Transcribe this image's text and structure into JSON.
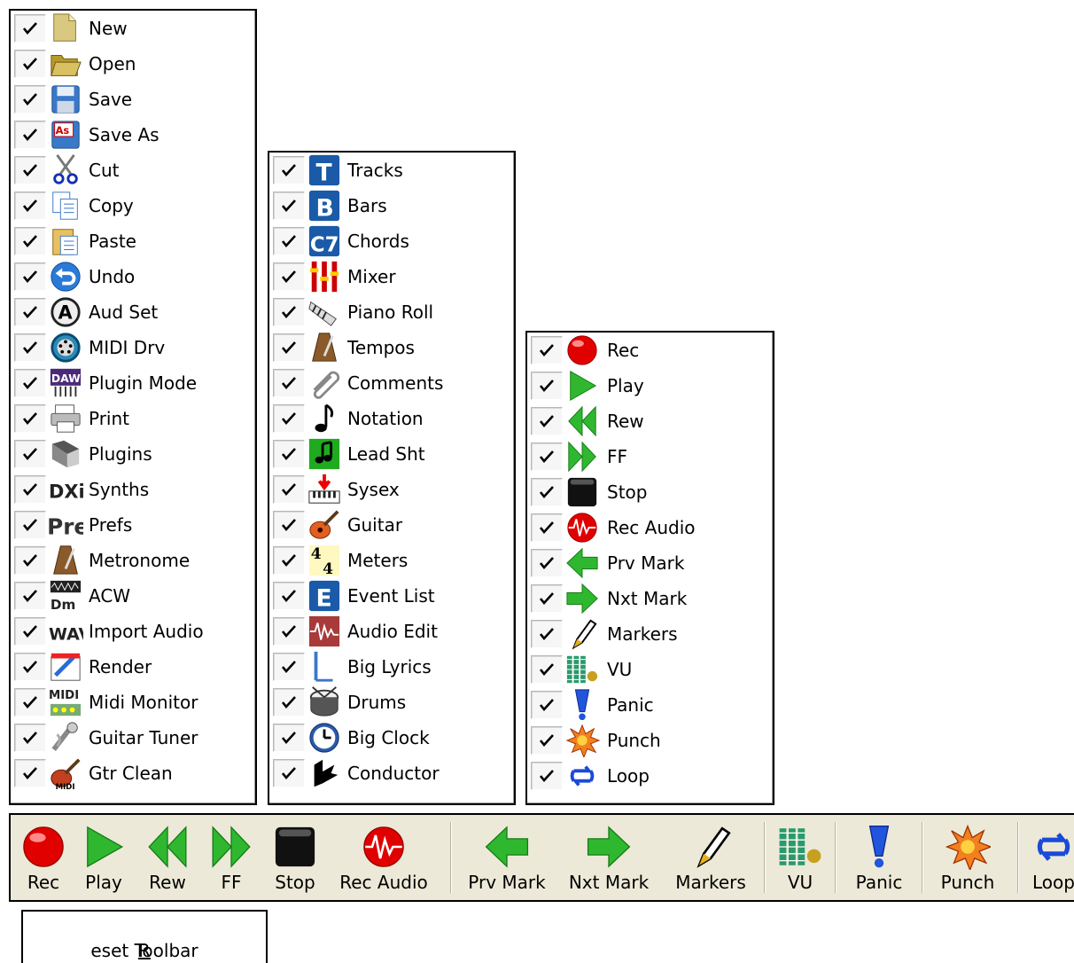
{
  "menus": [
    {
      "id": "file-edit",
      "items": [
        {
          "label": "New",
          "icon": "new-document-icon",
          "checked": true
        },
        {
          "label": "Open",
          "icon": "open-folder-icon",
          "checked": true
        },
        {
          "label": "Save",
          "icon": "save-disk-icon",
          "checked": true
        },
        {
          "label": "Save As",
          "icon": "save-as-icon",
          "checked": true
        },
        {
          "label": "Cut",
          "icon": "scissors-icon",
          "checked": true
        },
        {
          "label": "Copy",
          "icon": "copy-icon",
          "checked": true
        },
        {
          "label": "Paste",
          "icon": "paste-icon",
          "checked": true
        },
        {
          "label": "Undo",
          "icon": "undo-icon",
          "checked": true
        },
        {
          "label": "Aud Set",
          "icon": "audio-settings-icon",
          "checked": true
        },
        {
          "label": "MIDI Drv",
          "icon": "midi-driver-icon",
          "checked": true
        },
        {
          "label": "Plugin Mode",
          "icon": "daw-plugin-icon",
          "checked": true
        },
        {
          "label": "Print",
          "icon": "printer-icon",
          "checked": true
        },
        {
          "label": "Plugins",
          "icon": "plugins-icon",
          "checked": true
        },
        {
          "label": "Synths",
          "icon": "dxi-synths-icon",
          "checked": true
        },
        {
          "label": "Prefs",
          "icon": "prefs-icon",
          "checked": true
        },
        {
          "label": "Metronome",
          "icon": "metronome-icon",
          "checked": true
        },
        {
          "label": "ACW",
          "icon": "acw-icon",
          "checked": true
        },
        {
          "label": "Import Audio",
          "icon": "import-wav-icon",
          "checked": true
        },
        {
          "label": "Render",
          "icon": "render-icon",
          "checked": true
        },
        {
          "label": "Midi Monitor",
          "icon": "midi-monitor-icon",
          "checked": true
        },
        {
          "label": "Guitar Tuner",
          "icon": "guitar-tuner-icon",
          "checked": true
        },
        {
          "label": "Gtr Clean",
          "icon": "guitar-clean-icon",
          "checked": true
        }
      ]
    },
    {
      "id": "windows",
      "items": [
        {
          "label": "Tracks",
          "icon": "tracks-t-icon",
          "checked": true
        },
        {
          "label": "Bars",
          "icon": "bars-b-icon",
          "checked": true
        },
        {
          "label": "Chords",
          "icon": "chords-c7-icon",
          "checked": true
        },
        {
          "label": "Mixer",
          "icon": "mixer-faders-icon",
          "checked": true
        },
        {
          "label": "Piano Roll",
          "icon": "piano-roll-icon",
          "checked": true
        },
        {
          "label": "Tempos",
          "icon": "metronome-icon",
          "checked": true
        },
        {
          "label": "Comments",
          "icon": "paperclip-icon",
          "checked": true
        },
        {
          "label": "Notation",
          "icon": "music-note-icon",
          "checked": true
        },
        {
          "label": "Lead Sht",
          "icon": "lead-sheet-icon",
          "checked": true
        },
        {
          "label": "Sysex",
          "icon": "sysex-keyboard-icon",
          "checked": true
        },
        {
          "label": "Guitar",
          "icon": "guitar-icon",
          "checked": true
        },
        {
          "label": "Meters",
          "icon": "time-signature-icon",
          "checked": true
        },
        {
          "label": "Event List",
          "icon": "event-list-e-icon",
          "checked": true
        },
        {
          "label": "Audio Edit",
          "icon": "audio-waveform-icon",
          "checked": true
        },
        {
          "label": "Big Lyrics",
          "icon": "big-lyrics-icon",
          "checked": true
        },
        {
          "label": "Drums",
          "icon": "drum-icon",
          "checked": true
        },
        {
          "label": "Big Clock",
          "icon": "clock-icon",
          "checked": true
        },
        {
          "label": "Conductor",
          "icon": "conductor-icon",
          "checked": true
        }
      ]
    },
    {
      "id": "transport",
      "items": [
        {
          "label": "Rec",
          "icon": "record-icon",
          "checked": true
        },
        {
          "label": "Play",
          "icon": "play-icon",
          "checked": true
        },
        {
          "label": "Rew",
          "icon": "rewind-icon",
          "checked": true
        },
        {
          "label": "FF",
          "icon": "fast-forward-icon",
          "checked": true
        },
        {
          "label": "Stop",
          "icon": "stop-icon",
          "checked": true
        },
        {
          "label": "Rec Audio",
          "icon": "record-audio-icon",
          "checked": true
        },
        {
          "label": "Prv Mark",
          "icon": "previous-mark-icon",
          "checked": true
        },
        {
          "label": "Nxt Mark",
          "icon": "next-mark-icon",
          "checked": true
        },
        {
          "label": "Markers",
          "icon": "marker-pen-icon",
          "checked": true
        },
        {
          "label": "VU",
          "icon": "vu-meter-icon",
          "checked": true
        },
        {
          "label": "Panic",
          "icon": "panic-exclamation-icon",
          "checked": true
        },
        {
          "label": "Punch",
          "icon": "punch-burst-icon",
          "checked": true
        },
        {
          "label": "Loop",
          "icon": "loop-icon",
          "checked": true
        }
      ]
    }
  ],
  "toolbar": {
    "buttons": [
      {
        "label": "Rec",
        "icon": "record-icon"
      },
      {
        "label": "Play",
        "icon": "play-icon"
      },
      {
        "label": "Rew",
        "icon": "rewind-icon"
      },
      {
        "label": "FF",
        "icon": "fast-forward-icon"
      },
      {
        "label": "Stop",
        "icon": "stop-icon"
      },
      {
        "label": "Rec Audio",
        "icon": "record-audio-icon"
      },
      {
        "label": "Prv Mark",
        "icon": "previous-mark-icon"
      },
      {
        "label": "Nxt Mark",
        "icon": "next-mark-icon"
      },
      {
        "label": "Markers",
        "icon": "marker-pen-icon"
      },
      {
        "label": "VU",
        "icon": "vu-meter-icon"
      },
      {
        "label": "Panic",
        "icon": "panic-exclamation-icon"
      },
      {
        "label": "Punch",
        "icon": "punch-burst-icon"
      },
      {
        "label": "Loop",
        "icon": "loop-icon"
      }
    ]
  },
  "reset": {
    "label_accel": "R",
    "label_rest": "eset Toolbar"
  },
  "colors": {
    "toolbar_bg": "#ece9d8",
    "record_red": "#e00000",
    "play_green": "#2fb82f",
    "panic_blue": "#2255dd"
  }
}
